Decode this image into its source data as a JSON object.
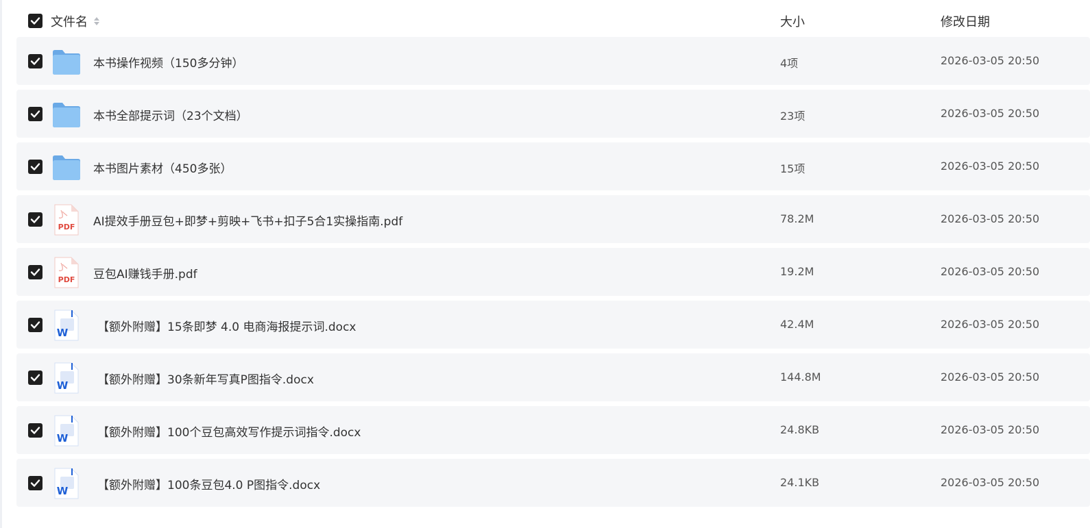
{
  "header": {
    "name_label": "文件名",
    "size_label": "大小",
    "date_label": "修改日期",
    "sort_icon": "sort-updown-icon"
  },
  "files": [
    {
      "type": "folder",
      "icon": "folder-icon",
      "name": "本书操作视频（150多分钟）",
      "size": "4项",
      "date": "2026-03-05 20:50",
      "checked": true
    },
    {
      "type": "folder",
      "icon": "folder-icon",
      "name": "本书全部提示词（23个文档）",
      "size": "23项",
      "date": "2026-03-05 20:50",
      "checked": true
    },
    {
      "type": "folder",
      "icon": "folder-icon",
      "name": "本书图片素材（450多张）",
      "size": "15项",
      "date": "2026-03-05 20:50",
      "checked": true
    },
    {
      "type": "pdf",
      "icon": "pdf-file-icon",
      "icon_label": "PDF",
      "name": "AI提效手册豆包+即梦+剪映+飞书+扣子5合1实操指南.pdf",
      "size": "78.2M",
      "date": "2026-03-05 20:50",
      "checked": true
    },
    {
      "type": "pdf",
      "icon": "pdf-file-icon",
      "icon_label": "PDF",
      "name": "豆包AI赚钱手册.pdf",
      "size": "19.2M",
      "date": "2026-03-05 20:50",
      "checked": true
    },
    {
      "type": "doc",
      "icon": "word-file-icon",
      "icon_label": "W",
      "name": "【额外附赠】15条即梦 4.0 电商海报提示词.docx",
      "size": "42.4M",
      "date": "2026-03-05 20:50",
      "checked": true
    },
    {
      "type": "doc",
      "icon": "word-file-icon",
      "icon_label": "W",
      "name": "【额外附赠】30条新年写真P图指令.docx",
      "size": "144.8M",
      "date": "2026-03-05 20:50",
      "checked": true
    },
    {
      "type": "doc",
      "icon": "word-file-icon",
      "icon_label": "W",
      "name": "【额外附赠】100个豆包高效写作提示词指令.docx",
      "size": "24.8KB",
      "date": "2026-03-05 20:50",
      "checked": true
    },
    {
      "type": "doc",
      "icon": "word-file-icon",
      "icon_label": "W",
      "name": "【额外附赠】100条豆包4.0 P图指令.docx",
      "size": "24.1KB",
      "date": "2026-03-05 20:50",
      "checked": true
    }
  ],
  "colors": {
    "row_bg": "#f5f6f8",
    "checkbox": "#1f1f1f",
    "folder": "#7db8ee",
    "pdf_red": "#e04a3f",
    "word_blue": "#1d5fd6"
  }
}
